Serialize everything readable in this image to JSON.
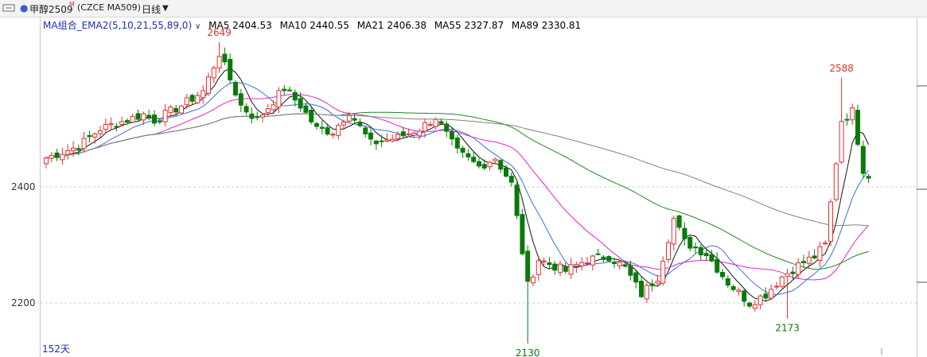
{
  "toolbar": {
    "title": "甲醇2509",
    "title_mark": "M",
    "code": "(CZCE MA509)",
    "period": "日线"
  },
  "ma_legend": {
    "group": "MA组合_EMA2(5,10,21,55,89,0)",
    "items": [
      {
        "label": "MA5 2404.53",
        "color": "#111111"
      },
      {
        "label": "MA10 2440.55",
        "color": "#3b6fd8"
      },
      {
        "label": "MA21 2406.38",
        "color": "#e020d0"
      },
      {
        "label": "MA55 2327.87",
        "color": "#1e8a1e"
      },
      {
        "label": "MA89 2330.81",
        "color": "#808080"
      }
    ]
  },
  "bar_count_label": "152天",
  "colors": {
    "up": "#e03030",
    "down": "#0a7a0a",
    "text_high": "#e03030",
    "text_low": "#0a7a0a"
  },
  "chart_data": {
    "type": "candlestick",
    "ylim": [
      2140,
      2680
    ],
    "y_ticks": [
      2200,
      2400
    ],
    "annotations": [
      {
        "text": "2649",
        "index": 32,
        "value": 2649,
        "kind": "high"
      },
      {
        "text": "2130",
        "index": 89,
        "value": 2130,
        "kind": "low"
      },
      {
        "text": "2173",
        "index": 137,
        "value": 2173,
        "kind": "low"
      },
      {
        "text": "2588",
        "index": 147,
        "value": 2588,
        "kind": "high"
      }
    ],
    "anchors": [
      [
        0,
        2450
      ],
      [
        6,
        2470
      ],
      [
        10,
        2500
      ],
      [
        18,
        2525
      ],
      [
        20,
        2515
      ],
      [
        25,
        2540
      ],
      [
        29,
        2565
      ],
      [
        32,
        2630
      ],
      [
        36,
        2540
      ],
      [
        39,
        2515
      ],
      [
        44,
        2570
      ],
      [
        47,
        2540
      ],
      [
        50,
        2500
      ],
      [
        53,
        2495
      ],
      [
        56,
        2530
      ],
      [
        60,
        2475
      ],
      [
        65,
        2485
      ],
      [
        69,
        2500
      ],
      [
        72,
        2520
      ],
      [
        76,
        2460
      ],
      [
        80,
        2435
      ],
      [
        83,
        2450
      ],
      [
        86,
        2405
      ],
      [
        89,
        2230
      ],
      [
        91,
        2275
      ],
      [
        96,
        2255
      ],
      [
        100,
        2275
      ],
      [
        104,
        2280
      ],
      [
        107,
        2260
      ],
      [
        110,
        2215
      ],
      [
        113,
        2245
      ],
      [
        116,
        2345
      ],
      [
        118,
        2305
      ],
      [
        122,
        2285
      ],
      [
        126,
        2235
      ],
      [
        130,
        2200
      ],
      [
        133,
        2215
      ],
      [
        136,
        2245
      ],
      [
        139,
        2265
      ],
      [
        142,
        2280
      ],
      [
        144,
        2300
      ],
      [
        147,
        2515
      ],
      [
        149,
        2530
      ],
      [
        151,
        2430
      ],
      [
        153,
        2410
      ]
    ],
    "series": [
      {
        "name": "MA5",
        "period": 5
      },
      {
        "name": "MA10",
        "period": 10
      },
      {
        "name": "MA21",
        "period": 21
      },
      {
        "name": "MA55",
        "period": 55
      },
      {
        "name": "MA89",
        "period": 89
      }
    ]
  }
}
